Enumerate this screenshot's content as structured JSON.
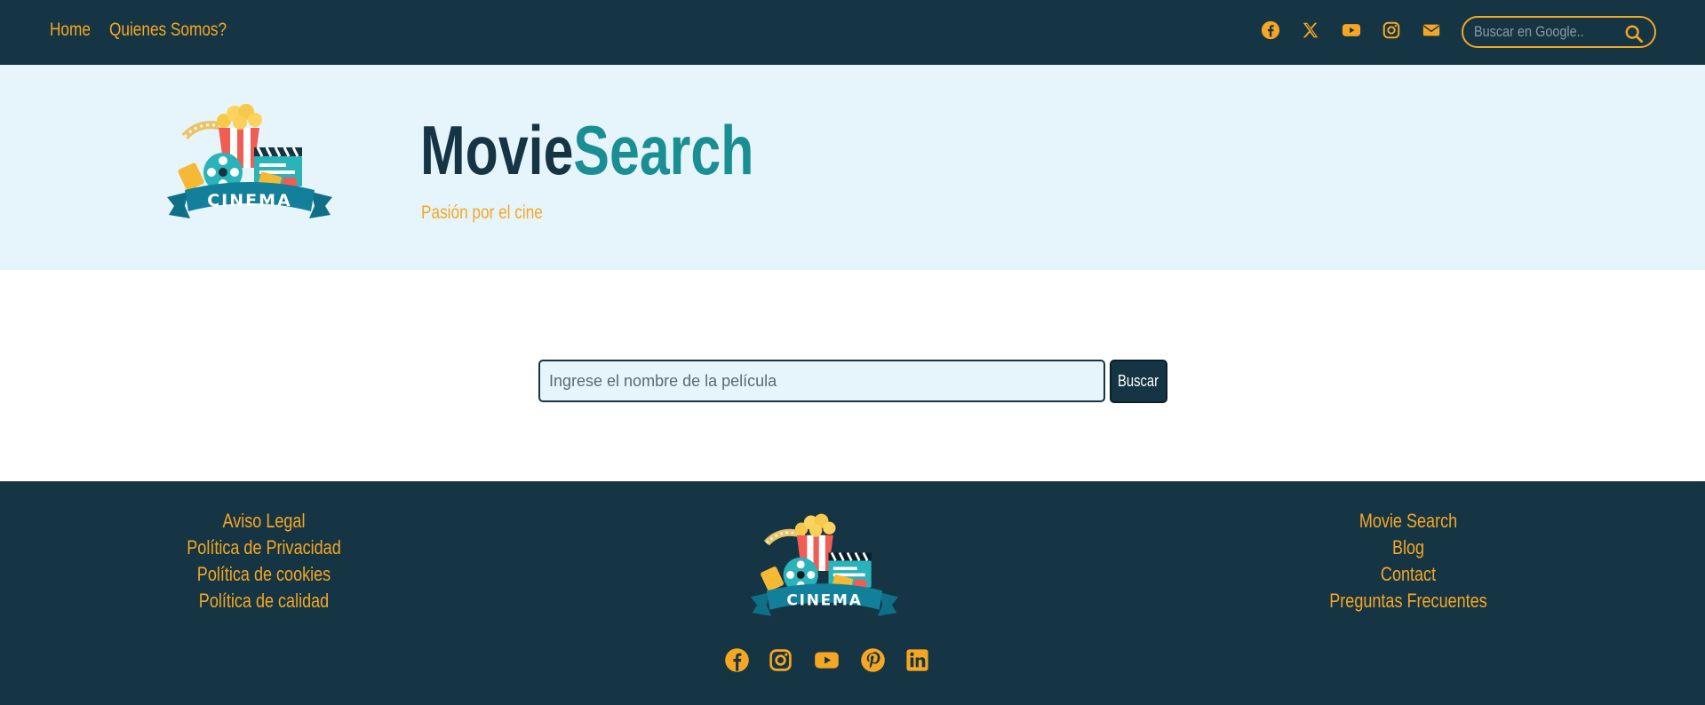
{
  "nav": {
    "home": "Home",
    "about": "Quienes Somos?",
    "social_icons": [
      "facebook-icon",
      "x-icon",
      "youtube-icon",
      "instagram-icon",
      "envelope-icon"
    ],
    "search_placeholder": "Buscar en Google.."
  },
  "header": {
    "logo_text": "CINEMA",
    "brand_part1": "Movie",
    "brand_part2": "Search",
    "tagline": "Pasión por el cine"
  },
  "search": {
    "placeholder": "Ingrese el nombre de la película",
    "value": "",
    "button_label": "Buscar"
  },
  "footer": {
    "left_links": [
      "Aviso Legal",
      "Política de Privacidad",
      "Política de cookies",
      "Política de calidad"
    ],
    "right_links": [
      "Movie Search",
      "Blog",
      "Contact",
      "Preguntas Frecuentes"
    ],
    "logo_text": "CINEMA",
    "social_icons": [
      "facebook-icon",
      "instagram-icon",
      "youtube-icon",
      "pinterest-icon",
      "linkedin-icon"
    ]
  },
  "colors": {
    "navy": "#163544",
    "orange": "#f5a623",
    "teal": "#1a8f93",
    "light_blue": "#e6f5fb"
  }
}
